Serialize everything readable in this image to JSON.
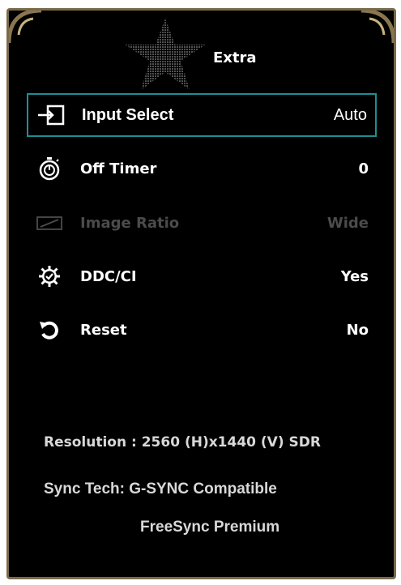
{
  "header": {
    "title": "Extra"
  },
  "menu": {
    "items": [
      {
        "icon": "input-select-icon",
        "label": "Input Select",
        "value": "Auto",
        "state": "selected"
      },
      {
        "icon": "stopwatch-icon",
        "label": "Off Timer",
        "value": "0",
        "state": "normal"
      },
      {
        "icon": "aspect-ratio-icon",
        "label": "Image Ratio",
        "value": "Wide",
        "state": "disabled"
      },
      {
        "icon": "gear-check-icon",
        "label": "DDC/CI",
        "value": "Yes",
        "state": "normal"
      },
      {
        "icon": "reset-icon",
        "label": "Reset",
        "value": "No",
        "state": "normal"
      }
    ]
  },
  "info": {
    "resolution": "Resolution : 2560  (H)x1440  (V)  SDR",
    "sync_tech": "Sync Tech: G-SYNC Compatible",
    "freesync": "FreeSync Premium"
  },
  "colors": {
    "background": "#000000",
    "frame": "#7a6a4c",
    "selection": "#1f8f94",
    "text": "#ffffff",
    "disabled_text": "#4b4b4b"
  }
}
